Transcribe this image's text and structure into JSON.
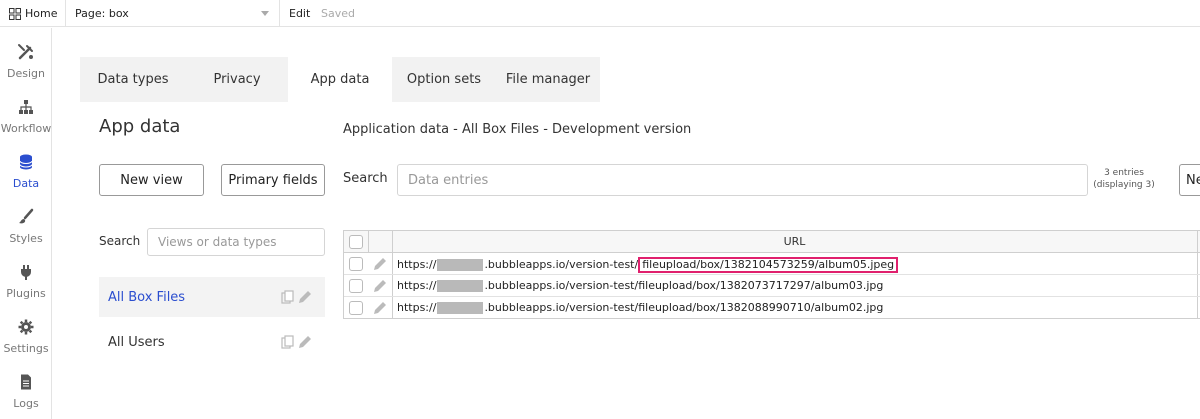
{
  "topbar": {
    "home_label": "Home",
    "page_label": "Page: box",
    "edit_label": "Edit",
    "saved_label": "Saved"
  },
  "rail": {
    "items": [
      {
        "label": "Design",
        "icon": "design-icon"
      },
      {
        "label": "Workflow",
        "icon": "workflow-icon"
      },
      {
        "label": "Data",
        "icon": "data-icon"
      },
      {
        "label": "Styles",
        "icon": "brush-icon"
      },
      {
        "label": "Plugins",
        "icon": "plug-icon"
      },
      {
        "label": "Settings",
        "icon": "gear-icon"
      },
      {
        "label": "Logs",
        "icon": "document-icon"
      }
    ],
    "active": "Data"
  },
  "tabs": {
    "items": [
      {
        "label": "Data types"
      },
      {
        "label": "Privacy"
      },
      {
        "label": "App data"
      },
      {
        "label": "Option sets"
      },
      {
        "label": "File manager"
      }
    ],
    "active": "App data"
  },
  "left_panel": {
    "title": "App data",
    "new_view_label": "New view",
    "primary_fields_label": "Primary fields",
    "search_label": "Search",
    "search_placeholder": "Views or data types",
    "views": [
      {
        "label": "All Box Files"
      },
      {
        "label": "All Users"
      }
    ]
  },
  "right_panel": {
    "title": "Application data - All Box Files - Development version",
    "search_label": "Search",
    "search_placeholder": "Data entries",
    "entries_line1": "3 entries",
    "entries_line2": "(displaying 3)",
    "new_button_label": "Ne",
    "table": {
      "header": "URL",
      "rows": [
        {
          "prefix": "https://",
          "domain": ".bubbleapps.io/version-test/",
          "path": "fileupload/box/1382104573259/album05.jpeg"
        },
        {
          "prefix": "https://",
          "domain": ".bubbleapps.io/version-test/",
          "path": "fileupload/box/1382073717297/album03.jpg"
        },
        {
          "prefix": "https://",
          "domain": ".bubbleapps.io/version-test/",
          "path": "fileupload/box/1382088990710/album02.jpg"
        }
      ]
    }
  },
  "colors": {
    "accent": "#2b4ecf",
    "highlight": "#e0206d"
  }
}
